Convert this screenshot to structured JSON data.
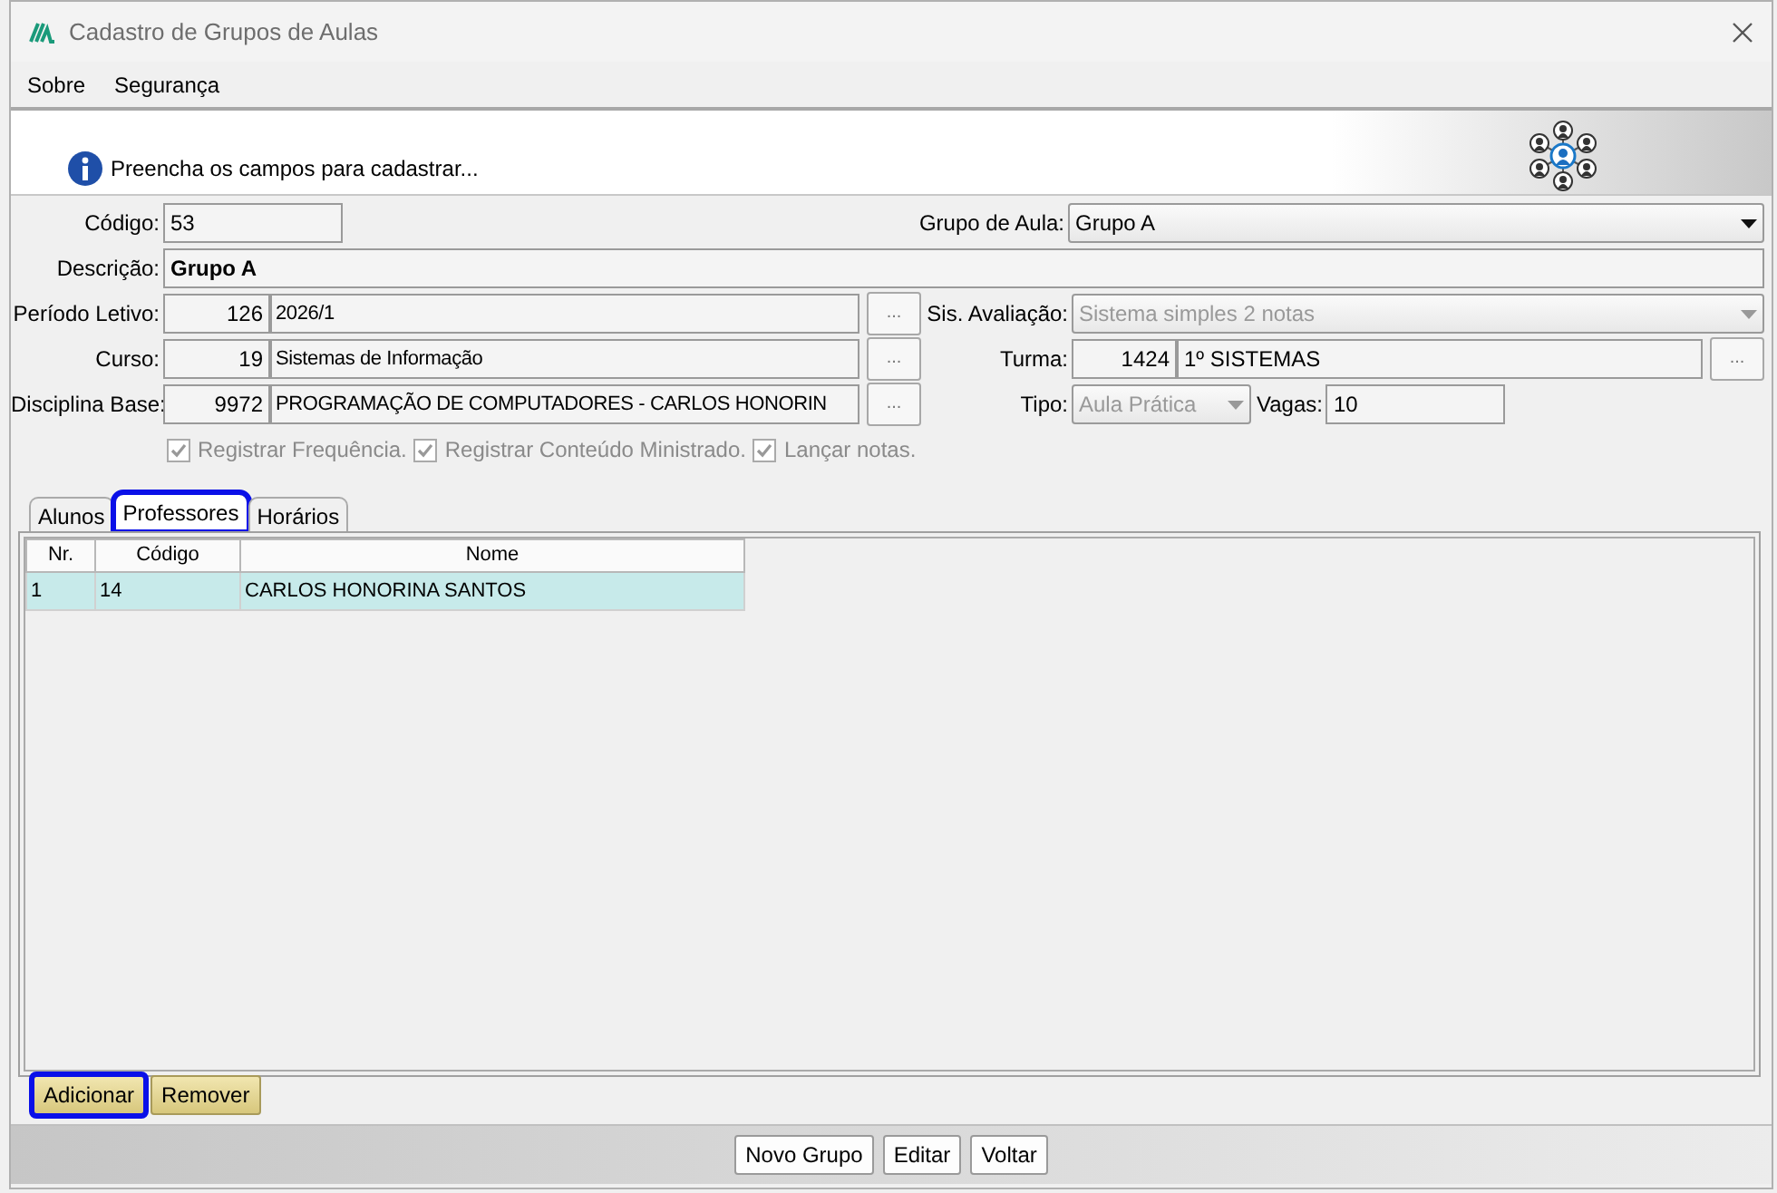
{
  "window": {
    "title": "Cadastro de Grupos de Aulas"
  },
  "menu": [
    {
      "label": "Sobre"
    },
    {
      "label": "Segurança"
    }
  ],
  "banner": {
    "message": "Preencha os campos para cadastrar..."
  },
  "form": {
    "codigo": {
      "label": "Código:",
      "value": "53"
    },
    "grupo_de_aula": {
      "label": "Grupo de Aula:",
      "value": "Grupo A",
      "disabled": false
    },
    "descricao": {
      "label": "Descrição:",
      "value": "Grupo A"
    },
    "periodo_letivo": {
      "label": "Período Letivo:",
      "code": "126",
      "name": "2026/1",
      "button": "..."
    },
    "sis_avaliacao": {
      "label": "Sis. Avaliação:",
      "value": "Sistema simples 2 notas",
      "disabled": true
    },
    "curso": {
      "label": "Curso:",
      "code": "19",
      "name": "Sistemas de Informação",
      "button": "..."
    },
    "turma": {
      "label": "Turma:",
      "code": "1424",
      "name": "1º SISTEMAS",
      "button": "..."
    },
    "disciplina_base": {
      "label": "Disciplina Base:",
      "code": "9972",
      "name": "PROGRAMAÇÃO DE COMPUTADORES - CARLOS HONORIN",
      "button": "..."
    },
    "tipo": {
      "label": "Tipo:",
      "value": "Aula Prática",
      "disabled": true
    },
    "vagas": {
      "label": "Vagas:",
      "value": "10"
    }
  },
  "options": [
    {
      "label": "Registrar Frequência.",
      "checked": true,
      "disabled": true
    },
    {
      "label": "Registrar Conteúdo Ministrado.",
      "checked": true,
      "disabled": true
    },
    {
      "label": "Lançar notas.",
      "checked": true,
      "disabled": true
    }
  ],
  "tabs": [
    {
      "label": "Alunos",
      "selected": false,
      "highlighted": false
    },
    {
      "label": "Professores",
      "selected": true,
      "highlighted": true
    },
    {
      "label": "Horários",
      "selected": false,
      "highlighted": false
    }
  ],
  "table": {
    "columns": [
      "Nr.",
      "Código",
      "Nome"
    ],
    "rows": [
      {
        "cells": [
          "1",
          "14",
          "CARLOS HONORINA SANTOS"
        ],
        "selected": true
      }
    ]
  },
  "tab_buttons": [
    {
      "label": "Adicionar",
      "highlighted": true
    },
    {
      "label": "Remover",
      "highlighted": false
    }
  ],
  "footer_buttons": [
    {
      "label": "Novo Grupo"
    },
    {
      "label": "Editar"
    },
    {
      "label": "Voltar"
    }
  ]
}
